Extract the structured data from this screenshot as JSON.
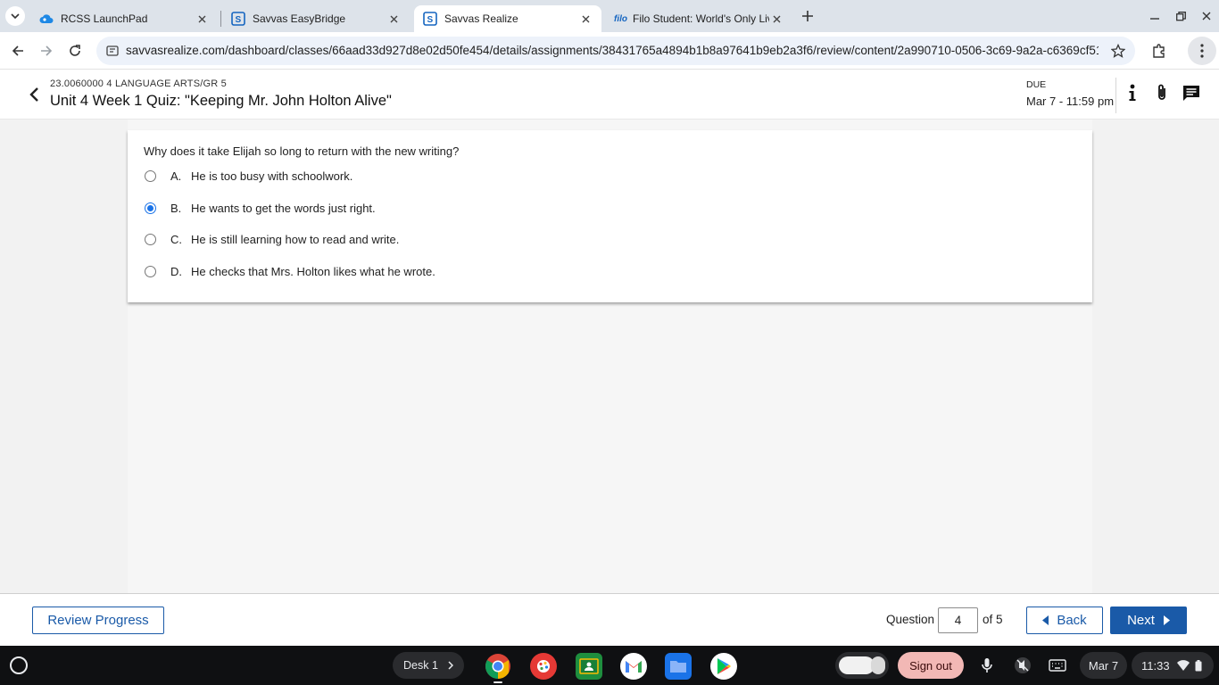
{
  "browser": {
    "tabs": [
      {
        "title": "RCSS LaunchPad",
        "icon": "cloud-icon",
        "active": false
      },
      {
        "title": "Savvas EasyBridge",
        "icon": "savvas-icon",
        "active": false
      },
      {
        "title": "Savvas Realize",
        "icon": "savvas-icon",
        "active": true
      },
      {
        "title": "Filo Student: World's Only Live",
        "icon": "filo-icon",
        "favicon_text": "filo",
        "active": false
      }
    ],
    "url": "savvasrealize.com/dashboard/classes/66aad33d927d8e02d50fe454/details/assignments/38431765a4894b1b8a97641b9eb2a3f6/review/content/2a990710-0506-3c69-9a2a-c6369cf5165e/...",
    "accent": "#1a73e8"
  },
  "header": {
    "course_code": "23.0060000 4 LANGUAGE ARTS/GR 5",
    "title": "Unit 4 Week 1 Quiz: \"Keeping Mr. John Holton Alive\"",
    "due_label": "DUE",
    "due_date": "Mar 7 - 11:59 pm"
  },
  "question": {
    "text": "Why does it take Elijah so long to return with the new writing?",
    "choices": [
      {
        "letter": "A.",
        "text": "He is too busy with schoolwork.",
        "selected": false
      },
      {
        "letter": "B.",
        "text": "He wants to get the words just right.",
        "selected": true
      },
      {
        "letter": "C.",
        "text": "He is still learning how to read and write.",
        "selected": false
      },
      {
        "letter": "D.",
        "text": "He checks that Mrs. Holton likes what he wrote.",
        "selected": false
      }
    ]
  },
  "footer": {
    "review_label": "Review Progress",
    "question_label": "Question",
    "question_number": "4",
    "of_label": "of 5",
    "back_label": "Back",
    "next_label": "Next",
    "primary_color": "#1a5aa8"
  },
  "shelf": {
    "desk_label": "Desk 1",
    "apps": [
      "chrome-icon",
      "canvas-icon",
      "classroom-icon",
      "gmail-icon",
      "files-icon",
      "play-store-icon"
    ],
    "signout_label": "Sign out",
    "date": "Mar 7",
    "time": "11:33"
  }
}
